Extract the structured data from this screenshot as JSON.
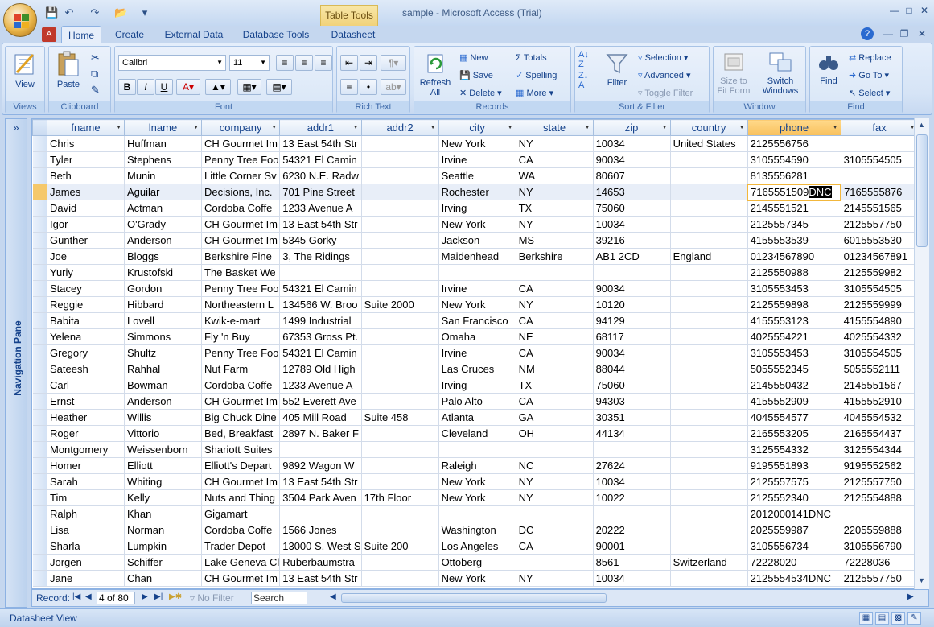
{
  "window": {
    "title": "sample - Microsoft Access (Trial)",
    "contextual_tab_group": "Table Tools"
  },
  "tabs": [
    {
      "label": "Home",
      "active": true
    },
    {
      "label": "Create"
    },
    {
      "label": "External Data"
    },
    {
      "label": "Database Tools"
    },
    {
      "label": "Datasheet"
    }
  ],
  "ribbon": {
    "views": {
      "label": "Views",
      "view_button": "View"
    },
    "clipboard": {
      "label": "Clipboard",
      "paste_button": "Paste"
    },
    "font": {
      "label": "Font",
      "font_name": "Calibri",
      "font_size": "11"
    },
    "rich_text": {
      "label": "Rich Text"
    },
    "records": {
      "label": "Records",
      "refresh_button": "Refresh All",
      "new": "New",
      "save": "Save",
      "delete": "Delete",
      "totals": "Totals",
      "spelling": "Spelling",
      "more": "More"
    },
    "sort_filter": {
      "label": "Sort & Filter",
      "filter": "Filter",
      "selection": "Selection",
      "advanced": "Advanced",
      "toggle_filter": "Toggle Filter"
    },
    "window": {
      "label": "Window",
      "size_to_fit": "Size to Fit Form",
      "switch_windows": "Switch Windows"
    },
    "find": {
      "label": "Find",
      "find": "Find",
      "replace": "Replace",
      "go_to": "Go To",
      "select": "Select"
    }
  },
  "nav_pane": {
    "label": "Navigation Pane"
  },
  "table": {
    "columns": [
      "fname",
      "lname",
      "company",
      "addr1",
      "addr2",
      "city",
      "state",
      "zip",
      "country",
      "phone",
      "fax"
    ],
    "current_row": 3,
    "editing_phone": {
      "prefix": "7165551509",
      "highlight": "DNC"
    },
    "rows": [
      [
        "Chris",
        "Huffman",
        "CH Gourmet Im",
        "13 East 54th Str",
        "",
        "New York",
        "NY",
        "10034",
        "United States",
        "2125556756",
        ""
      ],
      [
        "Tyler",
        "Stephens",
        "Penny Tree Foo",
        "54321 El Camin",
        "",
        "Irvine",
        "CA",
        "90034",
        "",
        "3105554590",
        "3105554505"
      ],
      [
        "Beth",
        "Munin",
        "Little Corner Sv",
        "6230 N.E. Radw",
        "",
        "Seattle",
        "WA",
        "80607",
        "",
        "8135556281",
        ""
      ],
      [
        "James",
        "Aguilar",
        "Decisions, Inc.",
        "701 Pine Street",
        "",
        "Rochester",
        "NY",
        "14653",
        "",
        "7165551509DNC",
        "7165555876"
      ],
      [
        "David",
        "Actman",
        "Cordoba Coffe",
        "1233 Avenue A",
        "",
        "Irving",
        "TX",
        "75060",
        "",
        "2145551521",
        "2145551565"
      ],
      [
        "Igor",
        "O'Grady",
        "CH Gourmet Im",
        "13 East 54th Str",
        "",
        "New York",
        "NY",
        "10034",
        "",
        "2125557345",
        "2125557750"
      ],
      [
        "Gunther",
        "Anderson",
        "CH Gourmet Im",
        "5345 Gorky",
        "",
        "Jackson",
        "MS",
        "39216",
        "",
        "4155553539",
        "6015553530"
      ],
      [
        "Joe",
        "Bloggs",
        "Berkshire Fine",
        "3, The Ridings",
        "",
        "Maidenhead",
        "Berkshire",
        "AB1 2CD",
        "England",
        "01234567890",
        "01234567891"
      ],
      [
        "Yuriy",
        "Krustofski",
        "The Basket We",
        "",
        "",
        "",
        "",
        "",
        "",
        "2125550988",
        "2125559982"
      ],
      [
        "Stacey",
        "Gordon",
        "Penny Tree Foo",
        "54321 El Camin",
        "",
        "Irvine",
        "CA",
        "90034",
        "",
        "3105553453",
        "3105554505"
      ],
      [
        "Reggie",
        "Hibbard",
        "Northeastern L",
        "134566 W. Broo",
        "Suite 2000",
        "New York",
        "NY",
        "10120",
        "",
        "2125559898",
        "2125559999"
      ],
      [
        "Babita",
        "Lovell",
        "Kwik-e-mart",
        "1499 Industrial",
        "",
        "San Francisco",
        "CA",
        "94129",
        "",
        "4155553123",
        "4155554890"
      ],
      [
        "Yelena",
        "Simmons",
        "Fly 'n Buy",
        "67353 Gross Pt.",
        "",
        "Omaha",
        "NE",
        "68117",
        "",
        "4025554221",
        "4025554332"
      ],
      [
        "Gregory",
        "Shultz",
        "Penny Tree Foo",
        "54321 El Camin",
        "",
        "Irvine",
        "CA",
        "90034",
        "",
        "3105553453",
        "3105554505"
      ],
      [
        "Sateesh",
        "Rahhal",
        "Nut Farm",
        "12789 Old High",
        "",
        "Las Cruces",
        "NM",
        "88044",
        "",
        "5055552345",
        "5055552111"
      ],
      [
        "Carl",
        "Bowman",
        "Cordoba Coffe",
        "1233 Avenue A",
        "",
        "Irving",
        "TX",
        "75060",
        "",
        "2145550432",
        "2145551567"
      ],
      [
        "Ernst",
        "Anderson",
        "CH Gourmet Im",
        "552 Everett Ave",
        "",
        "Palo Alto",
        "CA",
        "94303",
        "",
        "4155552909",
        "4155552910"
      ],
      [
        "Heather",
        "Willis",
        "Big Chuck Dine",
        "405 Mill Road",
        "Suite 458",
        "Atlanta",
        "GA",
        "30351",
        "",
        "4045554577",
        "4045554532"
      ],
      [
        "Roger",
        "Vittorio",
        "Bed, Breakfast",
        "2897 N. Baker F",
        "",
        "Cleveland",
        "OH",
        "44134",
        "",
        "2165553205",
        "2165554437"
      ],
      [
        "Montgomery",
        "Weissenborn",
        "Shariott Suites",
        "",
        "",
        "",
        "",
        "",
        "",
        "3125554332",
        "3125554344"
      ],
      [
        "Homer",
        "Elliott",
        "Elliott's Depart",
        "9892 Wagon W",
        "",
        "Raleigh",
        "NC",
        "27624",
        "",
        "9195551893",
        "9195552562"
      ],
      [
        "Sarah",
        "Whiting",
        "CH Gourmet Im",
        "13 East 54th Str",
        "",
        "New York",
        "NY",
        "10034",
        "",
        "2125557575",
        "2125557750"
      ],
      [
        "Tim",
        "Kelly",
        "Nuts and Thing",
        "3504 Park Aven",
        "17th Floor",
        "New York",
        "NY",
        "10022",
        "",
        "2125552340",
        "2125554888"
      ],
      [
        "Ralph",
        "Khan",
        "Gigamart",
        "",
        "",
        "",
        "",
        "",
        "",
        "2012000141DNC",
        ""
      ],
      [
        "Lisa",
        "Norman",
        "Cordoba Coffe",
        "1566 Jones",
        "",
        "Washington",
        "DC",
        "20222",
        "",
        "2025559987",
        "2205559888"
      ],
      [
        "Sharla",
        "Lumpkin",
        "Trader Depot",
        "13000 S. West S",
        "Suite 200",
        "Los Angeles",
        "CA",
        "90001",
        "",
        "3105556734",
        "3105556790"
      ],
      [
        "Jorgen",
        "Schiffer",
        "Lake Geneva Cl",
        "Ruberbaumstra",
        "",
        "Ottoberg",
        "",
        "8561",
        "Switzerland",
        "72228020",
        "72228036"
      ],
      [
        "Jane",
        "Chan",
        "CH Gourmet Im",
        "13 East 54th Str",
        "",
        "New York",
        "NY",
        "10034",
        "",
        "2125554534DNC",
        "2125557750"
      ]
    ]
  },
  "record_nav": {
    "label": "Record:",
    "position": "4 of 80",
    "filter_status": "No Filter",
    "search_placeholder": "Search"
  },
  "status_bar": {
    "text": "Datasheet View"
  }
}
